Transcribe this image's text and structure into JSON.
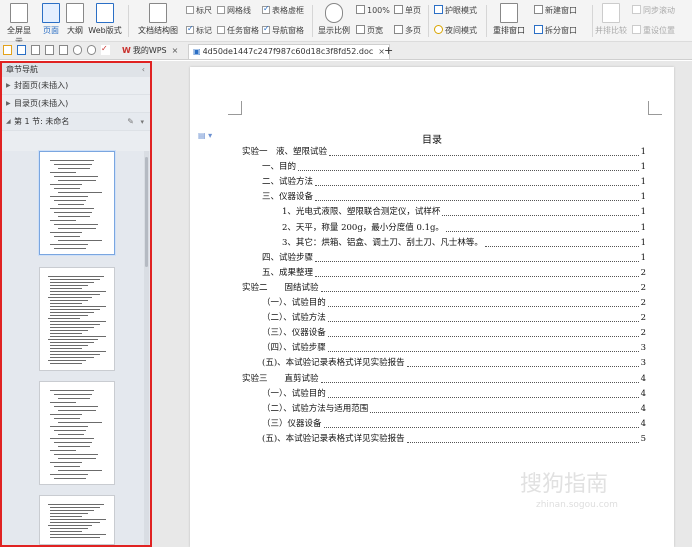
{
  "ribbon": {
    "fullscreen": "全屏显示",
    "page_view": "页面",
    "outline_view": "大纲",
    "web_view": "Web版式",
    "doc_structure": "文档结构图",
    "ruler": "标尺",
    "gridlines": "网格线",
    "table_border": "表格虚框",
    "marks": "标记",
    "task_pane": "任务窗格",
    "nav_pane": "导航窗格",
    "zoom": "显示比例",
    "zoom_100": "100%",
    "single_page": "单页",
    "page_width": "页宽",
    "multi_page": "多页",
    "eye_mode": "护眼模式",
    "night_mode": "夜间模式",
    "rearrange": "重排窗口",
    "new_window": "新建窗口",
    "split_window": "拆分窗口",
    "side_by_side": "并排比较",
    "sync_scroll": "同步滚动",
    "reset_pos": "重设位置"
  },
  "tabs": {
    "wps_tab": "我的WPS",
    "doc_tab": "4d50de1447c247f987c60d18c3f8fd52.doc",
    "add": "+"
  },
  "nav": {
    "title": "章节导航",
    "items": [
      {
        "label": "封面页(未插入)"
      },
      {
        "label": "目录页(未插入)"
      }
    ],
    "section": "第 1 节: 未命名"
  },
  "toc": {
    "title": "目录",
    "entries": [
      {
        "text": "实验一　液、塑限试验",
        "page": "1"
      },
      {
        "text": "一、目的",
        "page": "1"
      },
      {
        "text": "二、试验方法",
        "page": "1"
      },
      {
        "text": "三、仪器设备",
        "page": "1"
      },
      {
        "text": "1、光电式液限、塑限联合测定仪，试样杯",
        "page": "1"
      },
      {
        "text": "2、天平，称量 200g，最小分度值 0.1g。",
        "page": "1"
      },
      {
        "text": "3、其它：烘箱、铝盒、调土刀、刮土刀、凡士林等。",
        "page": "1"
      },
      {
        "text": "四、试验步骤",
        "page": "1"
      },
      {
        "text": "五、成果整理",
        "page": "2"
      },
      {
        "text": "实验二　　固结试验",
        "page": "2"
      },
      {
        "text": "（一）、试验目的",
        "page": "2"
      },
      {
        "text": "（二）、试验方法",
        "page": "2"
      },
      {
        "text": "（三）、仪器设备",
        "page": "2"
      },
      {
        "text": "（四）、试验步骤",
        "page": "3"
      },
      {
        "text": "(五)、本试验记录表格式详见实验报告",
        "page": "3"
      },
      {
        "text": "实验三　　直剪试验",
        "page": "4"
      },
      {
        "text": "（一）、试验目的",
        "page": "4"
      },
      {
        "text": "（二）、试验方法与适用范围",
        "page": "4"
      },
      {
        "text": "（三）仪器设备",
        "page": "4"
      },
      {
        "text": "(五)、本试验记录表格式详见实验报告",
        "page": "5"
      }
    ]
  },
  "watermark": {
    "main": "搜狗指南",
    "sub": "zhinan.sogou.com"
  }
}
